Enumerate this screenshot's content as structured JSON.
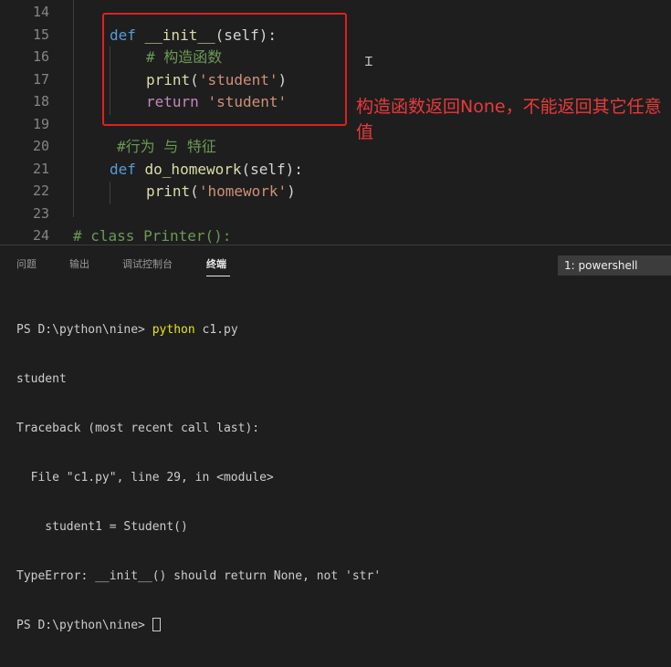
{
  "editor": {
    "lines": [
      {
        "num": "14"
      },
      {
        "num": "15",
        "indent": "def",
        "tokens": [
          {
            "t": "def ",
            "c": "kw"
          },
          {
            "t": "__init__",
            "c": "fn"
          },
          {
            "t": "(self):",
            "c": "pn"
          }
        ]
      },
      {
        "num": "16",
        "tokens": [
          {
            "t": "# 构造函数",
            "c": "cm"
          }
        ]
      },
      {
        "num": "17",
        "tokens": [
          {
            "t": "print",
            "c": "fn"
          },
          {
            "t": "(",
            "c": "pn"
          },
          {
            "t": "'student'",
            "c": "str"
          },
          {
            "t": ")",
            "c": "pn"
          }
        ]
      },
      {
        "num": "18",
        "tokens": [
          {
            "t": "return ",
            "c": "ret"
          },
          {
            "t": "'student'",
            "c": "str"
          }
        ]
      },
      {
        "num": "19"
      },
      {
        "num": "20",
        "tokens": [
          {
            "t": "#行为 与 特征",
            "c": "cm"
          }
        ]
      },
      {
        "num": "21",
        "tokens": [
          {
            "t": "def ",
            "c": "kw"
          },
          {
            "t": "do_homework",
            "c": "fn"
          },
          {
            "t": "(self):",
            "c": "pn"
          }
        ]
      },
      {
        "num": "22",
        "tokens": [
          {
            "t": "print",
            "c": "fn"
          },
          {
            "t": "(",
            "c": "pn"
          },
          {
            "t": "'homework'",
            "c": "str"
          },
          {
            "t": ")",
            "c": "pn"
          }
        ]
      },
      {
        "num": "23"
      },
      {
        "num": "24",
        "tokens": [
          {
            "t": "# class Printer():",
            "c": "cm"
          }
        ]
      }
    ],
    "annotation": "构造函数返回None，不能返回其它任意值"
  },
  "panel": {
    "tabs": [
      "问题",
      "输出",
      "调试控制台",
      "终端"
    ],
    "active_tab": "终端",
    "terminal_select": "1: powershell",
    "terminal": {
      "prompt1": "PS D:\\python\\nine> ",
      "cmd1": "python",
      "args1": " c1.py",
      "line2": "student",
      "line3": "Traceback (most recent call last):",
      "line4": "  File \"c1.py\", line 29, in <module>",
      "line5": "    student1 = Student()",
      "line6": "TypeError: __init__() should return None, not 'str'",
      "prompt2": "PS D:\\python\\nine> "
    }
  },
  "colors": {
    "background": "#1e1e1e",
    "highlight_box": "#e21f1f",
    "annotation_text": "#e83a3a",
    "keyword": "#569cd6",
    "function": "#dcdcaa",
    "string": "#ce9178",
    "comment": "#6a9955",
    "return_keyword": "#c586c0",
    "terminal_command": "#e5e510"
  }
}
